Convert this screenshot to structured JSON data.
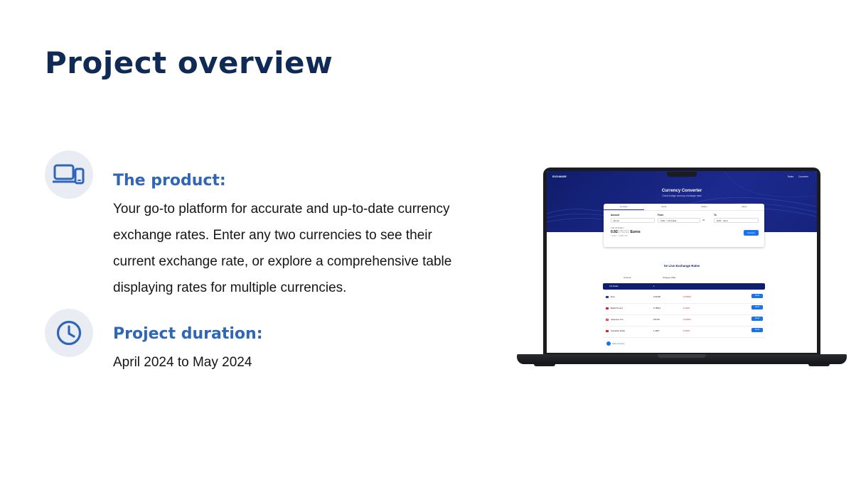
{
  "page": {
    "title": "Project overview"
  },
  "sections": [
    {
      "icon": "devices-icon",
      "heading": "The product:",
      "lines": [
        "Your go-to platform for accurate and up-to-date currency",
        "exchange rates. Enter any two currencies to see their",
        "current exchange rate, or explore a comprehensive table",
        "displaying rates for multiple currencies."
      ]
    },
    {
      "icon": "clock-icon",
      "heading": "Project duration:",
      "lines": [
        "April 2024 to May 2024"
      ]
    }
  ],
  "colors": {
    "title": "#0f2b55",
    "heading": "#2f66b8",
    "icon_bg": "#e9ecf3",
    "hero": "#16237d",
    "button": "#1a73e8",
    "negative": "#d92d3a"
  },
  "mockup": {
    "brand": "EXCHANGE",
    "nav": [
      "Rates",
      "Converter"
    ],
    "hero_title": "Currency Converter",
    "hero_subtitle": "Check foreign currency exchange rates",
    "tabs": [
      "Convert",
      "Send",
      "Charts",
      "Alerts"
    ],
    "amount_label": "Amount",
    "amount_value": "$1.00",
    "from_label": "From",
    "from_value": "USD – US Dollar",
    "to_label": "To",
    "to_value": "EUR – Euro",
    "result_small": "1.00 US Dollar =",
    "result_main": "0.92",
    "result_faded": "176211",
    "result_unit": "Euros",
    "result_note": "1 EUR = 1.0839 USD",
    "convert_button": "Convert",
    "table_title": "Xe Live Exchange Rates",
    "col_amount": "Amount",
    "col_change": "Change (24h)",
    "base_currency": "US Dollar",
    "base_amount": "1",
    "rows": [
      {
        "name": "Euro",
        "value": "0.92165",
        "change": "-0.0099%",
        "send": "Send",
        "flag": "#1f3ea8"
      },
      {
        "name": "British Pound",
        "value": "0.78512",
        "change": "-0.292%",
        "send": "Send",
        "flag": "#c8283c"
      },
      {
        "name": "Japanese Yen",
        "value": "155.68",
        "change": "-0.0255%",
        "send": "Send",
        "flag": "#e63946"
      },
      {
        "name": "Canadian Dollar",
        "value": "1.3667",
        "change": "-0.066%",
        "send": "Send",
        "flag": "#d62828"
      }
    ],
    "add_currency": "Add currency"
  }
}
